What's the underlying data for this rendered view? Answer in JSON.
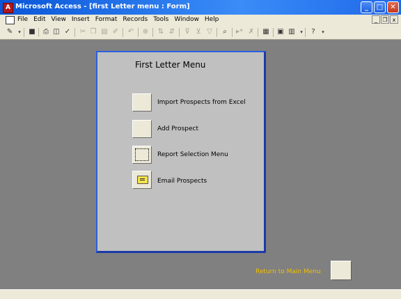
{
  "window": {
    "title": "Microsoft Access - [first Letter menu : Form]",
    "app_icon_letter": "A",
    "buttons": {
      "minimize": "_",
      "maximize": "□",
      "close": "✕"
    }
  },
  "menubar": {
    "items": [
      "File",
      "Edit",
      "View",
      "Insert",
      "Format",
      "Records",
      "Tools",
      "Window",
      "Help"
    ],
    "mdi_buttons": {
      "minimize": "_",
      "restore": "❐",
      "close": "x"
    }
  },
  "toolbar": {
    "icons": [
      "design-view-icon",
      "save-icon",
      "print-icon",
      "print-preview-icon",
      "spelling-icon",
      "cut-icon",
      "copy-icon",
      "paste-icon",
      "format-painter-icon",
      "undo-icon",
      "hyperlink-icon",
      "sort-icon",
      "filter-by-selection-icon",
      "filter-by-form-icon",
      "apply-filter-icon",
      "find-icon",
      "new-record-icon",
      "delete-record-icon",
      "properties-icon",
      "database-window-icon",
      "new-object-icon",
      "help-icon"
    ]
  },
  "form": {
    "title": "First Letter Menu",
    "commands": [
      {
        "label": "Import Prospects from Excel",
        "icon": "blank"
      },
      {
        "label": "Add Prospect",
        "icon": "blank"
      },
      {
        "label": "Report Selection Menu",
        "icon": "blank",
        "focused": true
      },
      {
        "label": "Email Prospects",
        "icon": "envelope-icon"
      }
    ]
  },
  "return": {
    "label": "Return to Main Menu"
  },
  "colors": {
    "accent": "#2c5fe0",
    "return_label": "#f0c000",
    "background": "#808080",
    "form_bg": "#c0c0c0"
  }
}
